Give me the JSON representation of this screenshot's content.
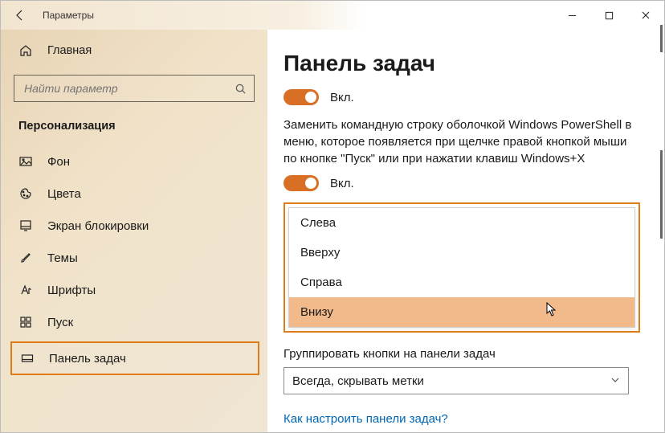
{
  "window": {
    "title": "Параметры"
  },
  "sidebar": {
    "home": "Главная",
    "search_placeholder": "Найти параметр",
    "section": "Персонализация",
    "items": [
      {
        "label": "Фон"
      },
      {
        "label": "Цвета"
      },
      {
        "label": "Экран блокировки"
      },
      {
        "label": "Темы"
      },
      {
        "label": "Шрифты"
      },
      {
        "label": "Пуск"
      },
      {
        "label": "Панель задач"
      }
    ]
  },
  "main": {
    "heading": "Панель задач",
    "toggle1_label": "Вкл.",
    "desc": "Заменить командную строку оболочкой Windows PowerShell в меню, которое появляется при щелчке правой кнопкой мыши по кнопке \"Пуск\" или при нажатии клавиш Windows+X",
    "toggle2_label": "Вкл.",
    "dropdown_options": [
      "Слева",
      "Вверху",
      "Справа",
      "Внизу"
    ],
    "group_label": "Группировать кнопки на панели задач",
    "group_value": "Всегда, скрывать метки",
    "help_link": "Как настроить панели задач?"
  }
}
